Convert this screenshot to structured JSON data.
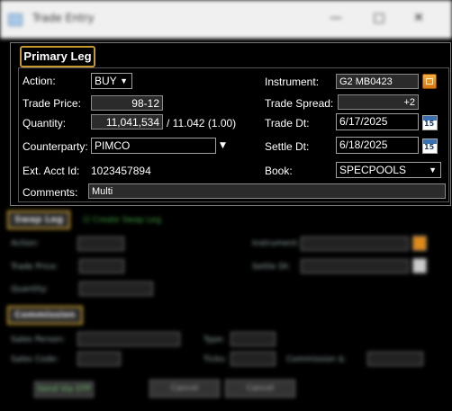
{
  "window": {
    "title": "Trade Entry"
  },
  "background": {
    "swap_tab": "Swap Leg",
    "create_swap_leg": "Create Swap Leg",
    "commission_tab": "Commission",
    "send_button": "Send Via STP",
    "cancel_button": "Cancel",
    "close_button": "Cancel",
    "swap_action": "Action:",
    "swap_trade_price": "Trade Price:",
    "swap_quantity": "Quantity:",
    "swap_instrument": "Instrument:",
    "swap_settle": "Settle Dt:",
    "sales_person": "Sales Person:",
    "sales_code": "Sales Code:",
    "type_lbl": "Type:",
    "ticks_lbl": "Ticks:",
    "commission_lbl": "Commission $:"
  },
  "primary_leg": {
    "tab_label": "Primary Leg",
    "action": {
      "label": "Action:",
      "value": "BUY"
    },
    "trade_price": {
      "label": "Trade Price:",
      "value": "98-12"
    },
    "quantity": {
      "label": "Quantity:",
      "value": "11,041,534",
      "suffix": "/ 11.042  (1.00)"
    },
    "counterparty": {
      "label": "Counterparty:",
      "value": "PIMCO"
    },
    "ext_acct": {
      "label": "Ext. Acct Id:",
      "value": "1023457894"
    },
    "comments": {
      "label": "Comments:",
      "value": "Multi"
    },
    "instrument": {
      "label": "Instrument:",
      "value": "G2 MB0423"
    },
    "trade_spread": {
      "label": "Trade Spread:",
      "value": "+2"
    },
    "trade_dt": {
      "label": "Trade Dt:",
      "value": "6/17/2025"
    },
    "settle_dt": {
      "label": "Settle Dt:",
      "value": "6/18/2025"
    },
    "book": {
      "label": "Book:",
      "value": "SPECPOOLS"
    },
    "calendar_day": "15"
  },
  "colors": {
    "accent": "#c49a2e",
    "calendar": "#3a6fb0",
    "instrument_button": "#e8901e"
  }
}
